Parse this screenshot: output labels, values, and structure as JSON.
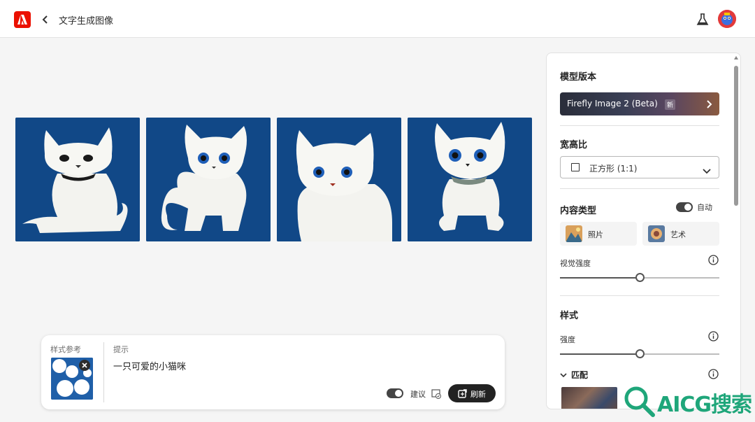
{
  "header": {
    "title": "文字生成图像"
  },
  "gallery": {
    "items": [
      {
        "label": "cat-1"
      },
      {
        "label": "cat-2"
      },
      {
        "label": "cat-3"
      },
      {
        "label": "cat-4"
      }
    ]
  },
  "prompt_panel": {
    "style_ref_label": "样式参考",
    "prompt_label": "提示",
    "prompt_value": "一只可爱的小猫咪",
    "suggest_label": "建议",
    "refresh_label": "刷新"
  },
  "settings": {
    "model_version_heading": "模型版本",
    "model_name": "Firefly Image 2 (Beta)",
    "model_badge": "新",
    "aspect_heading": "宽高比",
    "aspect_value": "正方形 (1:1)",
    "content_type_heading": "内容类型",
    "auto_label": "自动",
    "type_photo": "照片",
    "type_art": "艺术",
    "visual_strength_label": "视觉强度",
    "visual_strength_value": 0.5,
    "style_heading": "样式",
    "strength_label": "强度",
    "strength_value": 0.5,
    "match_label": "匹配"
  },
  "watermark": {
    "text": "AICG搜索"
  },
  "colors": {
    "brand": "#eb1000",
    "thumb_bg": "#114887",
    "button_dark": "#222222"
  }
}
